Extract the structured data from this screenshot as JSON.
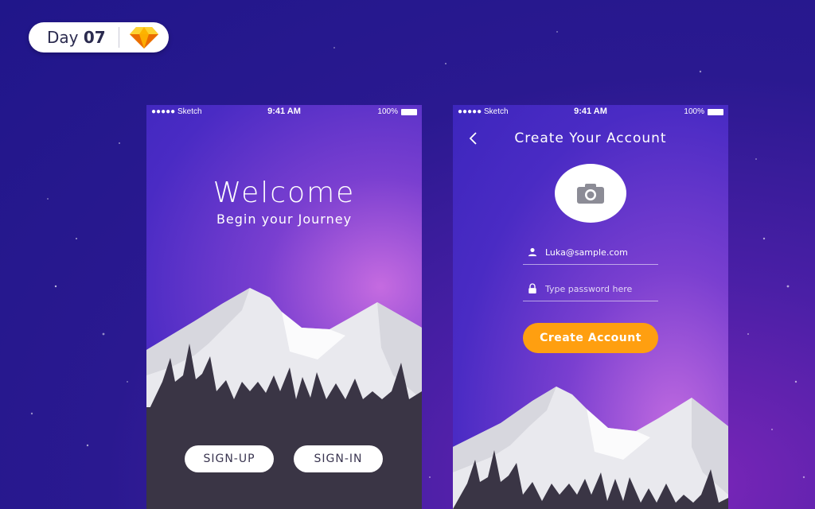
{
  "badge": {
    "day_prefix": "Day ",
    "day_number": "07",
    "icon": "sketch-diamond-icon"
  },
  "colors": {
    "accent": "#ff9f10",
    "ground": "#3a3545",
    "purple": "#4a2bc4"
  },
  "screens": {
    "welcome": {
      "status": {
        "carrier": "●●●●● Sketch",
        "time": "9:41 AM",
        "battery": "100%"
      },
      "title": "Welcome",
      "subtitle": "Begin your Journey",
      "signup_label": "SIGN-UP",
      "signin_label": "SIGN-IN"
    },
    "create": {
      "status": {
        "carrier": "●●●●● Sketch",
        "time": "9:41 AM",
        "battery": "100%"
      },
      "title": "Create Your Account",
      "back_icon": "chevron-left-icon",
      "avatar_icon": "camera-icon",
      "email_value": "Luka@sample.com",
      "password_placeholder": "Type password here",
      "cta_label": "Create Account"
    }
  }
}
